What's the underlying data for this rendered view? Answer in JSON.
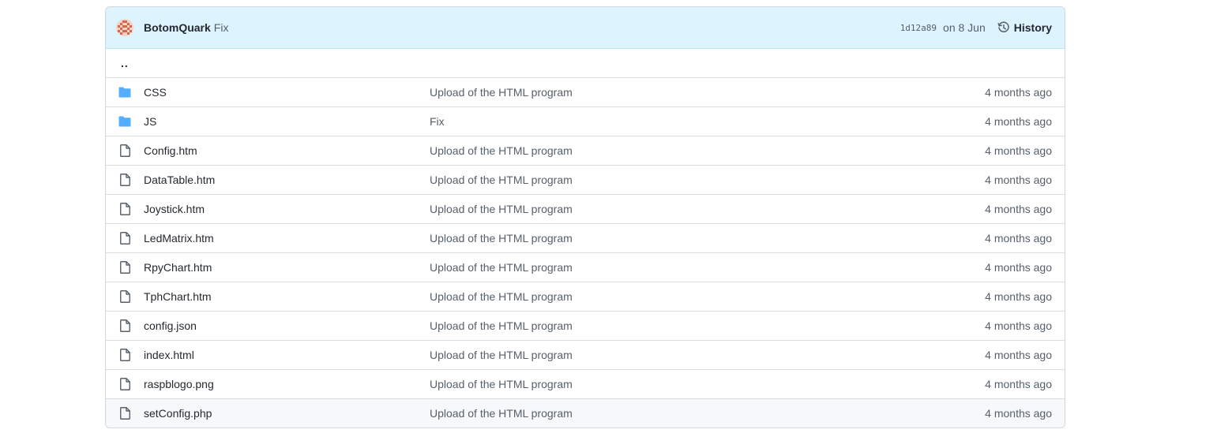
{
  "commit": {
    "author": "BotomQuark",
    "message": "Fix",
    "sha": "1d12a89",
    "date": "on 8 Jun",
    "history_label": "History"
  },
  "parent_link": "..",
  "colors": {
    "header_bg": "#ddf4ff",
    "folder_icon": "#54aeff",
    "file_icon": "#57606a",
    "muted_text": "#57606a"
  },
  "rows": [
    {
      "type": "folder",
      "icon": "folder-icon",
      "name": "CSS",
      "message": "Upload of the HTML program",
      "age": "4 months ago"
    },
    {
      "type": "folder",
      "icon": "folder-icon",
      "name": "JS",
      "message": "Fix",
      "age": "4 months ago"
    },
    {
      "type": "file",
      "icon": "file-icon",
      "name": "Config.htm",
      "message": "Upload of the HTML program",
      "age": "4 months ago"
    },
    {
      "type": "file",
      "icon": "file-icon",
      "name": "DataTable.htm",
      "message": "Upload of the HTML program",
      "age": "4 months ago"
    },
    {
      "type": "file",
      "icon": "file-icon",
      "name": "Joystick.htm",
      "message": "Upload of the HTML program",
      "age": "4 months ago"
    },
    {
      "type": "file",
      "icon": "file-icon",
      "name": "LedMatrix.htm",
      "message": "Upload of the HTML program",
      "age": "4 months ago"
    },
    {
      "type": "file",
      "icon": "file-icon",
      "name": "RpyChart.htm",
      "message": "Upload of the HTML program",
      "age": "4 months ago"
    },
    {
      "type": "file",
      "icon": "file-icon",
      "name": "TphChart.htm",
      "message": "Upload of the HTML program",
      "age": "4 months ago"
    },
    {
      "type": "file",
      "icon": "file-icon",
      "name": "config.json",
      "message": "Upload of the HTML program",
      "age": "4 months ago"
    },
    {
      "type": "file",
      "icon": "file-icon",
      "name": "index.html",
      "message": "Upload of the HTML program",
      "age": "4 months ago"
    },
    {
      "type": "file",
      "icon": "file-icon",
      "name": "raspblogo.png",
      "message": "Upload of the HTML program",
      "age": "4 months ago"
    },
    {
      "type": "file",
      "icon": "file-icon",
      "name": "setConfig.php",
      "message": "Upload of the HTML program",
      "age": "4 months ago"
    }
  ]
}
